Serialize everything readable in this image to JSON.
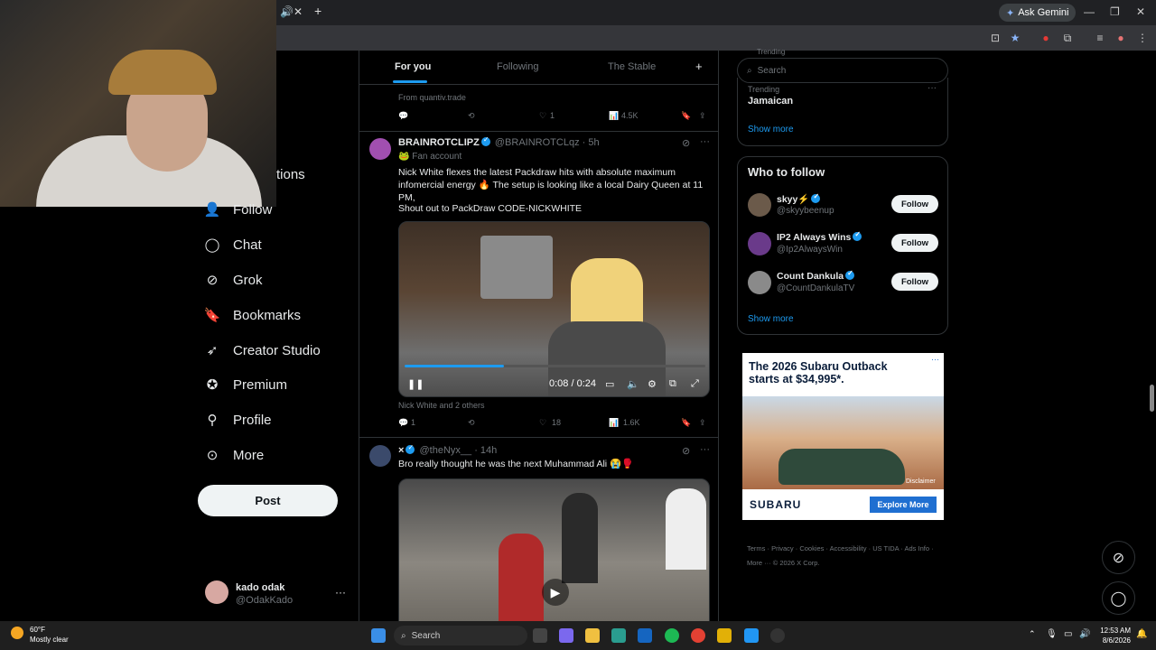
{
  "browser": {
    "ask_gemini": "Ask Gemini",
    "tab_close": "✕",
    "new_tab": "+"
  },
  "sidebar": {
    "partial_item": "tions",
    "items": [
      {
        "label": "Follow",
        "icon": "person-plus-icon"
      },
      {
        "label": "Chat",
        "icon": "chat-icon"
      },
      {
        "label": "Grok",
        "icon": "grok-icon"
      },
      {
        "label": "Bookmarks",
        "icon": "bookmark-icon"
      },
      {
        "label": "Creator Studio",
        "icon": "rocket-icon"
      },
      {
        "label": "Premium",
        "icon": "verified-icon"
      },
      {
        "label": "Profile",
        "icon": "profile-icon"
      },
      {
        "label": "More",
        "icon": "more-circle-icon"
      }
    ],
    "post_label": "Post",
    "account": {
      "name": "kado odak",
      "handle": "@OdakKado",
      "more": "···"
    }
  },
  "timeline": {
    "tabs": [
      "For you",
      "Following",
      "The Stable"
    ],
    "tab_plus": "+",
    "prev_tweet": {
      "source": "From quantiv.trade",
      "likes": "1",
      "views": "4.5K"
    },
    "tweet1": {
      "name": "BRAINROTCLIPZ",
      "handle": "@BRAINROTCLqz",
      "time": "· 5h",
      "label": "🐸 Fan account",
      "text1": "Nick White flexes the latest Packdraw hits with absolute maximum infomercial energy 🔥 The setup is looking like a local Dairy Queen at 11 PM,",
      "text2": "Shout out to PackDraw CODE-NICKWHITE",
      "video_time": "0:08 / 0:24",
      "video_progress": 0.33,
      "tagged": "Nick White and 2 others",
      "replies": "1",
      "likes": "18",
      "views": "1.6K"
    },
    "tweet2": {
      "name": "×",
      "handle": "@theNyx__",
      "time": "· 14h",
      "text": "Bro really thought he was the next Muhammad Ali 😭🥊"
    }
  },
  "right": {
    "search_placeholder": "Search",
    "trending_label_top": "Trending",
    "trending_label": "Trending",
    "trending_topic": "Jamaican",
    "show_more": "Show more",
    "wtf_title": "Who to follow",
    "follow_label": "Follow",
    "wtf": [
      {
        "name": "skyy⚡",
        "handle": "@skyybeenup"
      },
      {
        "name": "IP2 Always Wins",
        "handle": "@Ip2AlwaysWin"
      },
      {
        "name": "Count Dankula",
        "handle": "@CountDankulaTV"
      }
    ],
    "show_more_2": "Show more",
    "ad": {
      "title": "The 2026 Subaru Outback starts at $34,995*.",
      "disclaimer": "Disclaimer",
      "brand": "SUBARU",
      "cta": "Explore More"
    },
    "footer": "Terms · Privacy · Cookies · Accessibility · US TIDA · Ads Info · More ··· © 2026 X Corp."
  },
  "taskbar": {
    "temp": "60°F",
    "weather": "Mostly clear",
    "search": "Search",
    "time": "12:53 AM",
    "date": "8/6/2026"
  }
}
